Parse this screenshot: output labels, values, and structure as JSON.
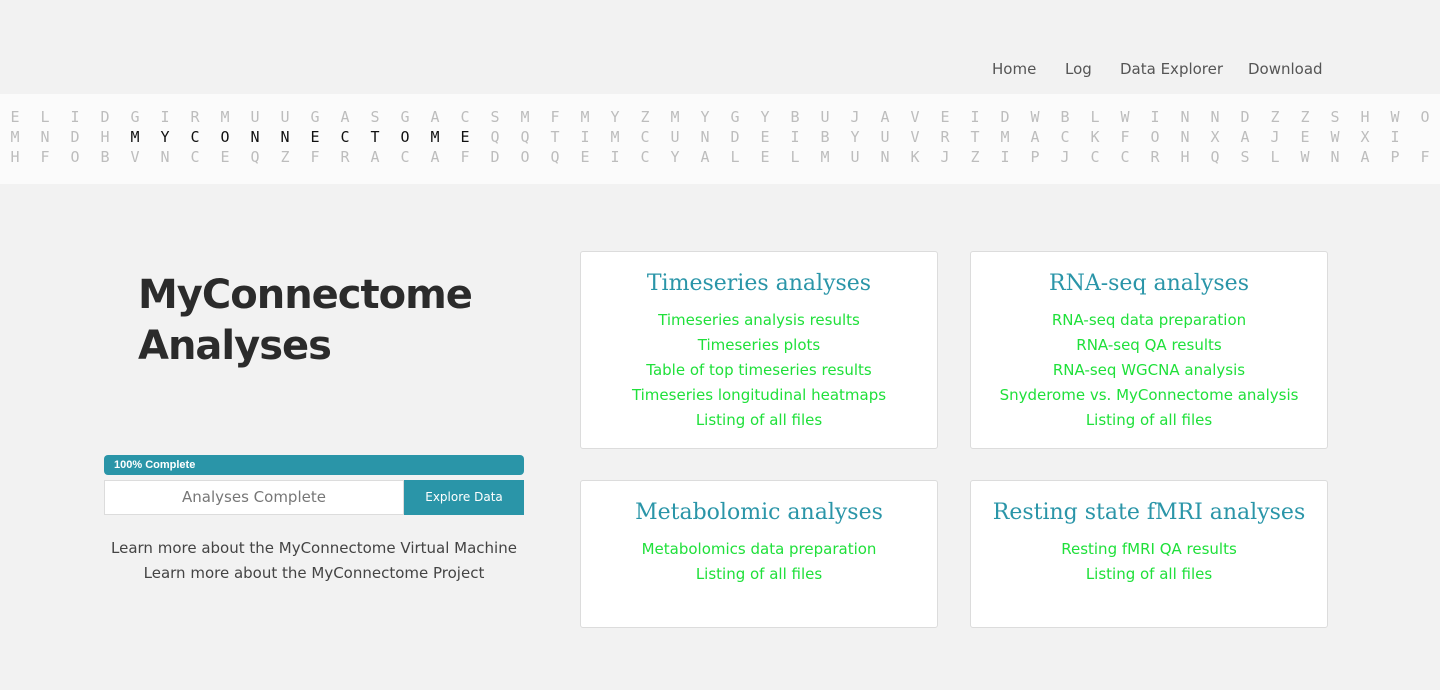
{
  "nav": {
    "items": [
      "Home",
      "Log",
      "Data Explorer",
      "Download"
    ]
  },
  "banner": {
    "rows": [
      "ELIDGIRMUUGASGACSMFMYZMYGYBUJAVEIDWBLWINNDZZSHWO",
      "MNDHMYCONNECTOMEQQTIMCUNDEIBYUVRTMACKFONXAJEWXI",
      "HFOBVNCEQZFRACAFDOQEICYALELMUNKJZIPJCCRHQSLWNAPFZ"
    ],
    "highlight_text": "MYCONNECTOME"
  },
  "page": {
    "title_line1": "MyConnectome",
    "title_line2": "Analyses"
  },
  "progress": {
    "value": 100,
    "label": "100% Complete"
  },
  "status": {
    "text": "Analyses Complete",
    "button_label": "Explore Data"
  },
  "learn_links": [
    "Learn more about the MyConnectome Virtual Machine",
    "Learn more about the MyConnectome Project"
  ],
  "cards": [
    {
      "title": "Timeseries analyses",
      "links": [
        "Timeseries analysis results",
        "Timeseries plots",
        "Table of top timeseries results",
        "Timeseries longitudinal heatmaps",
        "Listing of all files"
      ]
    },
    {
      "title": "RNA-seq analyses",
      "links": [
        "RNA-seq data preparation",
        "RNA-seq QA results",
        "RNA-seq WGCNA analysis",
        "Snyderome vs. MyConnectome analysis",
        "Listing of all files"
      ]
    },
    {
      "title": "Metabolomic analyses",
      "links": [
        "Metabolomics data preparation",
        "Listing of all files"
      ]
    },
    {
      "title": "Resting state fMRI analyses",
      "links": [
        "Resting fMRI QA results",
        "Listing of all files"
      ]
    }
  ],
  "colors": {
    "accent": "#2a95a8",
    "link_green": "#1fe03a",
    "title_dark": "#2b2b2b",
    "banner_letter": "#bdbdbd"
  }
}
